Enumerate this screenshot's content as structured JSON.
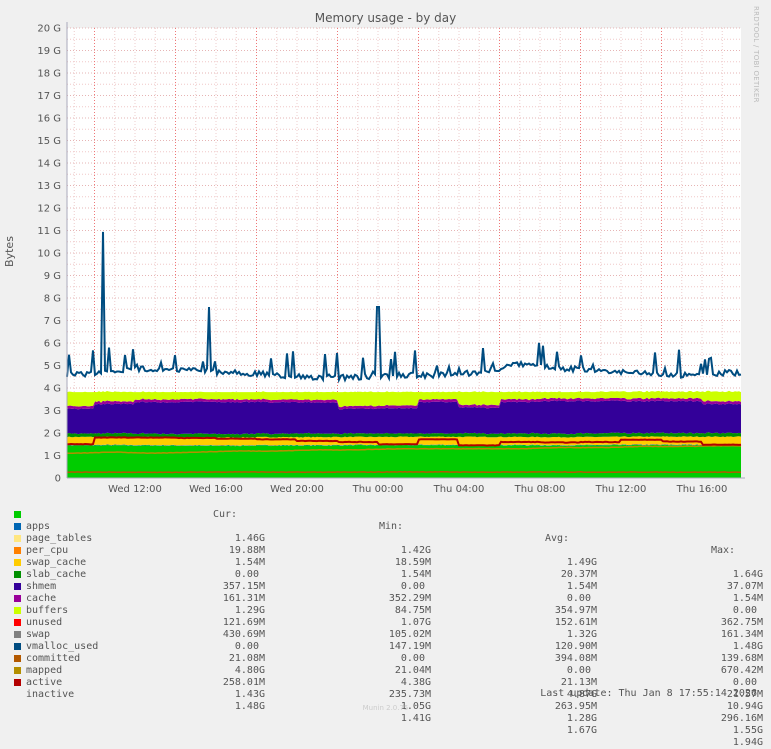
{
  "chart_data": {
    "type": "area",
    "title": "Memory usage - by day",
    "ylabel": "Bytes",
    "ylim": [
      0,
      20
    ],
    "y_unit": "G",
    "y_ticks": [
      "0",
      "1 G",
      "2 G",
      "3 G",
      "4 G",
      "5 G",
      "6 G",
      "7 G",
      "8 G",
      "9 G",
      "10 G",
      "11 G",
      "12 G",
      "13 G",
      "14 G",
      "15 G",
      "16 G",
      "17 G",
      "18 G",
      "19 G",
      "20 G"
    ],
    "x_ticks": [
      "Wed 12:00",
      "Wed 16:00",
      "Wed 20:00",
      "Thu 00:00",
      "Thu 04:00",
      "Thu 08:00",
      "Thu 12:00",
      "Thu 16:00"
    ],
    "x_range": [
      "Wed 08:38",
      "Thu 17:55"
    ],
    "grid": true,
    "x": [
      "Wed 09:00",
      "Wed 11:00",
      "Wed 13:00",
      "Wed 15:00",
      "Wed 17:00",
      "Wed 19:00",
      "Wed 21:00",
      "Wed 23:00",
      "Thu 01:00",
      "Thu 03:00",
      "Thu 05:00",
      "Thu 07:00",
      "Thu 09:00",
      "Thu 11:00",
      "Thu 13:00",
      "Thu 15:00",
      "Thu 17:00"
    ],
    "stacked_series_G": [
      {
        "name": "apps",
        "color": "#00cc00",
        "values": [
          1.45,
          1.45,
          1.44,
          1.43,
          1.43,
          1.44,
          1.44,
          1.45,
          1.45,
          1.46,
          1.45,
          1.45,
          1.44,
          1.45,
          1.46,
          1.46,
          1.46
        ]
      },
      {
        "name": "page_tables",
        "color": "#0066b3",
        "values": [
          0.02,
          0.02,
          0.02,
          0.02,
          0.02,
          0.02,
          0.02,
          0.02,
          0.02,
          0.02,
          0.02,
          0.02,
          0.02,
          0.02,
          0.02,
          0.02,
          0.02
        ]
      },
      {
        "name": "per_cpu",
        "color": "#ffe680",
        "values": [
          0.0015,
          0.0015,
          0.0015,
          0.0015,
          0.0015,
          0.0015,
          0.0015,
          0.0015,
          0.0015,
          0.0015,
          0.0015,
          0.0015,
          0.0015,
          0.0015,
          0.0015,
          0.0015,
          0.0015
        ]
      },
      {
        "name": "swap_cache",
        "color": "#ff8000",
        "values": [
          0,
          0,
          0,
          0,
          0,
          0,
          0,
          0,
          0,
          0,
          0,
          0,
          0,
          0,
          0,
          0,
          0
        ]
      },
      {
        "name": "slab_cache",
        "color": "#ffcc00",
        "values": [
          0.355,
          0.355,
          0.355,
          0.355,
          0.355,
          0.355,
          0.355,
          0.355,
          0.355,
          0.355,
          0.355,
          0.355,
          0.355,
          0.355,
          0.355,
          0.355,
          0.357
        ]
      },
      {
        "name": "shmem",
        "color": "#008f00",
        "values": [
          0.15,
          0.155,
          0.155,
          0.155,
          0.155,
          0.155,
          0.155,
          0.15,
          0.15,
          0.155,
          0.15,
          0.155,
          0.155,
          0.16,
          0.16,
          0.16,
          0.161
        ]
      },
      {
        "name": "cache",
        "color": "#330099",
        "values": [
          1.1,
          1.3,
          1.4,
          1.42,
          1.42,
          1.4,
          1.38,
          1.1,
          1.12,
          1.4,
          1.15,
          1.4,
          1.45,
          1.43,
          1.42,
          1.42,
          1.29
        ]
      },
      {
        "name": "buffers",
        "color": "#990099",
        "values": [
          0.12,
          0.12,
          0.12,
          0.12,
          0.12,
          0.12,
          0.12,
          0.12,
          0.12,
          0.12,
          0.12,
          0.12,
          0.12,
          0.12,
          0.12,
          0.12,
          0.12
        ]
      },
      {
        "name": "unused",
        "color": "#ccff00",
        "values": [
          0.62,
          0.42,
          0.32,
          0.3,
          0.3,
          0.32,
          0.34,
          0.62,
          0.6,
          0.32,
          0.57,
          0.32,
          0.27,
          0.29,
          0.3,
          0.3,
          0.43
        ]
      }
    ],
    "line_series_G": [
      {
        "name": "committed",
        "color": "#004c80",
        "values": [
          4.7,
          4.9,
          5.0,
          4.9,
          4.8,
          4.7,
          4.6,
          4.6,
          4.7,
          4.7,
          4.8,
          5.2,
          5.0,
          4.9,
          4.8,
          4.7,
          4.8
        ],
        "spikes": [
          {
            "x": "Wed 10:25",
            "value": 10.94
          },
          {
            "x": "Wed 15:40",
            "value": 7.6
          },
          {
            "x": "Thu 00:00",
            "value": 7.6
          }
        ]
      },
      {
        "name": "mapped",
        "color": "#b35900",
        "values": [
          0.26,
          0.26,
          0.25,
          0.26,
          0.27,
          0.26,
          0.26,
          0.26,
          0.27,
          0.27,
          0.26,
          0.26,
          0.27,
          0.26,
          0.26,
          0.26,
          0.26
        ]
      },
      {
        "name": "active",
        "color": "#b38f00",
        "values": [
          1.1,
          1.15,
          1.1,
          1.15,
          1.2,
          1.2,
          1.25,
          1.25,
          1.3,
          1.3,
          1.3,
          1.3,
          1.35,
          1.35,
          1.4,
          1.4,
          1.43
        ]
      },
      {
        "name": "inactive",
        "color": "#b30000",
        "values": [
          1.5,
          1.8,
          1.8,
          1.78,
          1.75,
          1.72,
          1.65,
          1.6,
          1.5,
          1.72,
          1.45,
          1.6,
          1.58,
          1.6,
          1.7,
          1.62,
          1.48
        ]
      }
    ]
  },
  "legend": {
    "headers": {
      "cur": "Cur:",
      "min": "Min:",
      "avg": "Avg:",
      "max": "Max:"
    },
    "rows": [
      {
        "name": "apps",
        "color": "#00cc00",
        "cur": "1.46G",
        "min": "1.42G",
        "avg": "1.49G",
        "max": "1.64G"
      },
      {
        "name": "page_tables",
        "color": "#0066b3",
        "cur": "19.88M",
        "min": "18.59M",
        "avg": "20.37M",
        "max": "37.07M"
      },
      {
        "name": "per_cpu",
        "color": "#ffe680",
        "cur": "1.54M",
        "min": "1.54M",
        "avg": "1.54M",
        "max": "1.54M"
      },
      {
        "name": "swap_cache",
        "color": "#ff8000",
        "cur": "0.00 ",
        "min": "0.00 ",
        "avg": "0.00 ",
        "max": "0.00 "
      },
      {
        "name": "slab_cache",
        "color": "#ffcc00",
        "cur": "357.15M",
        "min": "352.29M",
        "avg": "354.97M",
        "max": "362.75M"
      },
      {
        "name": "shmem",
        "color": "#008f00",
        "cur": "161.31M",
        "min": "84.75M",
        "avg": "152.61M",
        "max": "161.34M"
      },
      {
        "name": "cache",
        "color": "#330099",
        "cur": "1.29G",
        "min": "1.07G",
        "avg": "1.32G",
        "max": "1.48G"
      },
      {
        "name": "buffers",
        "color": "#990099",
        "cur": "121.69M",
        "min": "105.02M",
        "avg": "120.90M",
        "max": "139.68M"
      },
      {
        "name": "unused",
        "color": "#ccff00",
        "cur": "430.69M",
        "min": "147.19M",
        "avg": "394.08M",
        "max": "670.42M"
      },
      {
        "name": "swap",
        "color": "#ff0000",
        "cur": "0.00 ",
        "min": "0.00 ",
        "avg": "0.00 ",
        "max": "0.00 "
      },
      {
        "name": "vmalloc_used",
        "color": "#808080",
        "cur": "21.08M",
        "min": "21.04M",
        "avg": "21.13M",
        "max": "21.57M"
      },
      {
        "name": "committed",
        "color": "#004c80",
        "cur": "4.80G",
        "min": "4.38G",
        "avg": "4.87G",
        "max": "10.94G"
      },
      {
        "name": "mapped",
        "color": "#b35900",
        "cur": "258.01M",
        "min": "235.73M",
        "avg": "263.95M",
        "max": "296.16M"
      },
      {
        "name": "active",
        "color": "#b38f00",
        "cur": "1.43G",
        "min": "1.05G",
        "avg": "1.28G",
        "max": "1.55G"
      },
      {
        "name": "inactive",
        "color": "#b30000",
        "cur": "1.48G",
        "min": "1.41G",
        "avg": "1.67G",
        "max": "1.94G"
      }
    ],
    "last_update": "Last update: Thu Jan  8 17:55:14 2026"
  },
  "side_text": "RRDTOOL / TOBI OETIKER",
  "footer": "Munin 2.0.75"
}
